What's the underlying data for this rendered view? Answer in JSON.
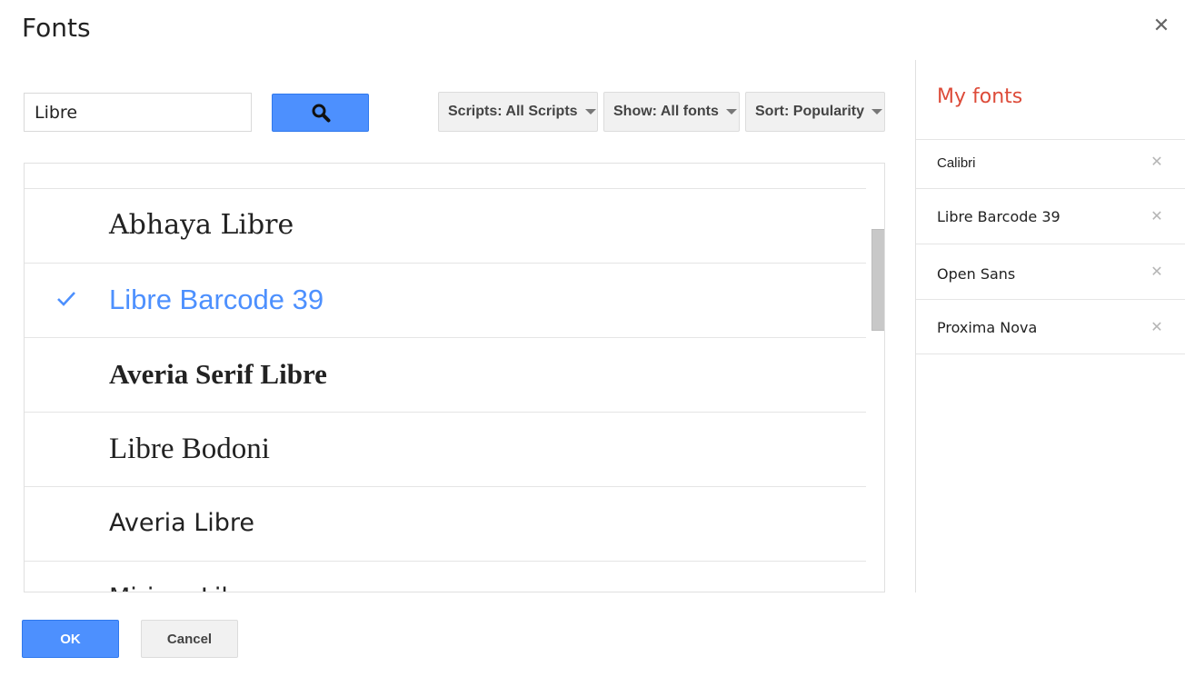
{
  "dialog": {
    "title": "Fonts",
    "close_icon": "close-icon"
  },
  "search": {
    "value": "Libre",
    "button_icon": "search-icon"
  },
  "filters": {
    "scripts_label": "Scripts: All Scripts",
    "show_label": "Show: All fonts",
    "sort_label": "Sort: Popularity"
  },
  "font_list": {
    "items": [
      {
        "name": "Abhaya Libre",
        "selected": false
      },
      {
        "name": "Libre Barcode 39",
        "selected": true
      },
      {
        "name": "Averia Serif Libre",
        "selected": false
      },
      {
        "name": "Libre Bodoni",
        "selected": false
      },
      {
        "name": "Averia Libre",
        "selected": false
      },
      {
        "name": "Miriam Libre",
        "selected": false
      }
    ]
  },
  "my_fonts": {
    "title": "My fonts",
    "items": [
      {
        "label": "Calibri"
      },
      {
        "label": "Libre Barcode 39"
      },
      {
        "label": "Open Sans"
      },
      {
        "label": "Proxima Nova"
      }
    ]
  },
  "footer": {
    "ok_label": "OK",
    "cancel_label": "Cancel"
  },
  "colors": {
    "accent": "#4d90fe",
    "my_fonts_title": "#dd4b39"
  }
}
